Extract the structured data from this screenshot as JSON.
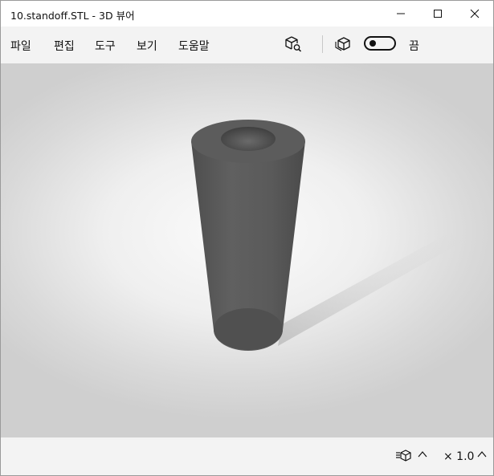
{
  "window": {
    "title": "10.standoff.STL - 3D 뷰어"
  },
  "caption": {
    "minimize": "—",
    "maximize": "☐",
    "close": "✕"
  },
  "menu": {
    "items": [
      "파일",
      "편집",
      "도구",
      "보기",
      "도움말"
    ]
  },
  "toolbar": {
    "toggle_label": "끔",
    "toggle_on": false
  },
  "statusbar": {
    "zoom": "× 1.0"
  },
  "colors": {
    "model": "#5a5a5a",
    "menubar": "#f3f3f3",
    "viewport_bg": "#e6e6e6"
  },
  "icons": {
    "view_tool": "cube-search-icon",
    "render_tool": "wireframe-cube-icon",
    "status_tool": "cube-list-icon"
  }
}
